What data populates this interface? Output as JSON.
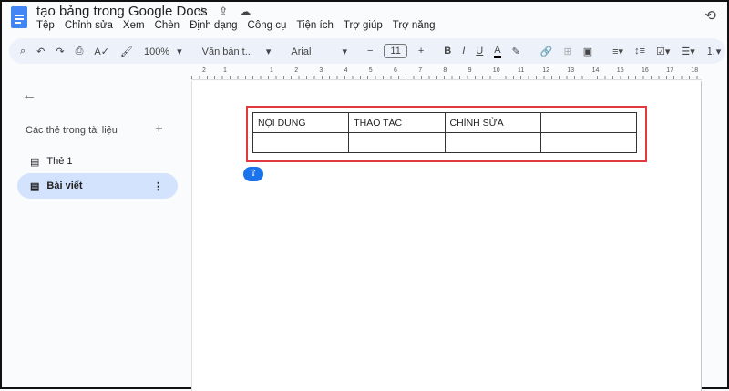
{
  "header": {
    "title": "tạo bảng trong Google Docs",
    "menu": [
      "Tệp",
      "Chỉnh sửa",
      "Xem",
      "Chèn",
      "Định dạng",
      "Công cụ",
      "Tiện ích",
      "Trợ giúp",
      "Trợ năng"
    ]
  },
  "toolbar": {
    "zoom": "100%",
    "style": "Văn bản t...",
    "font": "Arial",
    "font_size": "11"
  },
  "ruler": {
    "labels": [
      "2",
      "1",
      "1",
      "2",
      "3",
      "4",
      "5",
      "6",
      "7",
      "8",
      "9",
      "10",
      "11",
      "12",
      "13",
      "14",
      "15",
      "16",
      "17",
      "18"
    ]
  },
  "sidebar": {
    "heading": "Các thẻ trong tài liệu",
    "items": [
      {
        "label": "Thẻ 1"
      },
      {
        "label": "Bài viết",
        "selected": true
      }
    ]
  },
  "table": {
    "rows": [
      [
        "NỘI DUNG",
        "THAO TÁC",
        "CHỈNH SỬA",
        ""
      ],
      [
        "",
        "",
        "",
        ""
      ]
    ]
  },
  "colors": {
    "highlight": "#e0393e",
    "accent": "#1a73e8",
    "selected": "#d3e3fd"
  }
}
